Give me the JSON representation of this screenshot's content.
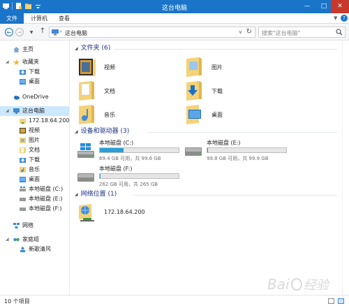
{
  "window": {
    "title": "这台电脑",
    "min_icon": "minimize-icon",
    "max_icon": "maximize-icon",
    "close_icon": "close-icon"
  },
  "ribbon": {
    "tabs": [
      {
        "label": "文件"
      },
      {
        "label": "计算机"
      },
      {
        "label": "查看"
      }
    ]
  },
  "address": {
    "crumb": "这台电脑",
    "search_placeholder": "搜索\"这台电脑\""
  },
  "nav": {
    "favorites": {
      "label": "收藏夹"
    },
    "home": {
      "label": "主页"
    },
    "fav_items": [
      {
        "label": "下载"
      },
      {
        "label": "桌面"
      }
    ],
    "onedrive": {
      "label": "OneDrive"
    },
    "thispc": {
      "label": "这台电脑"
    },
    "pc_items": [
      {
        "label": "172.18.64.200"
      },
      {
        "label": "视频"
      },
      {
        "label": "图片"
      },
      {
        "label": "文档"
      },
      {
        "label": "下载"
      },
      {
        "label": "音乐"
      },
      {
        "label": "桌面"
      },
      {
        "label": "本地磁盘 (C:)"
      },
      {
        "label": "本地磁盘 (E:)"
      },
      {
        "label": "本地磁盘 (F:)"
      }
    ],
    "network": {
      "label": "网络"
    },
    "homegroup": {
      "label": "家庭组"
    },
    "homegroup_items": [
      {
        "label": "新歌清风"
      }
    ]
  },
  "content": {
    "folders": {
      "header": "文件夹 (6)",
      "items": [
        {
          "label": "视频"
        },
        {
          "label": "图片"
        },
        {
          "label": "文档"
        },
        {
          "label": "下载"
        },
        {
          "label": "音乐"
        },
        {
          "label": "桌面"
        }
      ]
    },
    "devices": {
      "header": "设备和驱动器 (3)",
      "drives": [
        {
          "name": "本地磁盘 (C:)",
          "free": "69.4 GB 可用，共 99.6 GB",
          "used_fraction": 0.3
        },
        {
          "name": "本地磁盘 (E:)",
          "free": "99.8 GB 可用，共 99.9 GB",
          "used_fraction": 0.002
        },
        {
          "name": "本地磁盘 (F:)",
          "free": "262 GB 可用，共 265 GB",
          "used_fraction": 0.012
        }
      ]
    },
    "network": {
      "header": "网络位置 (1)",
      "items": [
        {
          "label": "172.18.64.200"
        }
      ]
    }
  },
  "status": {
    "count": "10 个项目"
  },
  "colors": {
    "accent": "#1a75c9",
    "close": "#c7392b",
    "bar_fill": "#26a0da",
    "selection": "#cce8ff",
    "group_text": "#1e3287"
  }
}
